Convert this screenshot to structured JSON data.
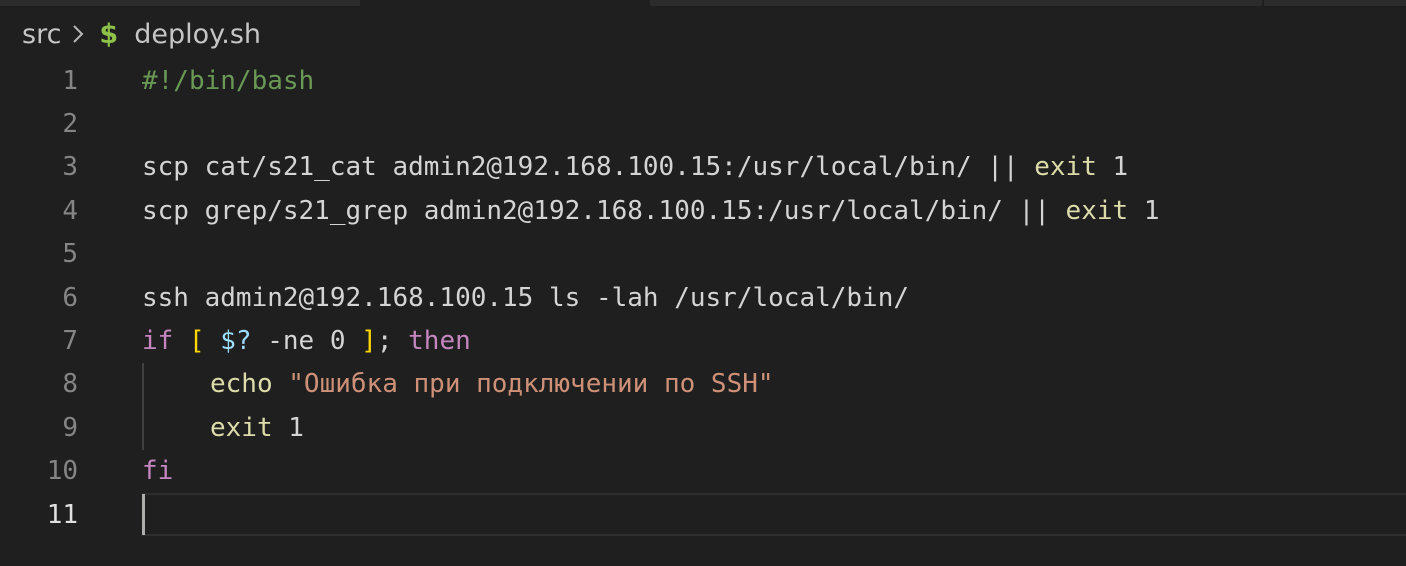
{
  "breadcrumb": {
    "folder": "src",
    "file_icon": "$",
    "file": "deploy.sh"
  },
  "lines": [
    {
      "n": "1",
      "tokens": [
        {
          "t": "#!/bin/bash",
          "c": "comment"
        }
      ]
    },
    {
      "n": "2",
      "tokens": []
    },
    {
      "n": "3",
      "tokens": [
        {
          "t": "scp cat/s21_cat admin2@192.168.100.15:/usr/local/bin/ || ",
          "c": "plain"
        },
        {
          "t": "exit",
          "c": "fn"
        },
        {
          "t": " 1",
          "c": "num"
        }
      ]
    },
    {
      "n": "4",
      "tokens": [
        {
          "t": "scp grep/s21_grep admin2@192.168.100.15:/usr/local/bin/ || ",
          "c": "plain"
        },
        {
          "t": "exit",
          "c": "fn"
        },
        {
          "t": " 1",
          "c": "num"
        }
      ]
    },
    {
      "n": "5",
      "tokens": []
    },
    {
      "n": "6",
      "tokens": [
        {
          "t": "ssh admin2@192.168.100.15 ls -lah /usr/local/bin/",
          "c": "plain"
        }
      ]
    },
    {
      "n": "7",
      "tokens": [
        {
          "t": "if",
          "c": "kw"
        },
        {
          "t": " ",
          "c": "plain"
        },
        {
          "t": "[",
          "c": "bracket"
        },
        {
          "t": " ",
          "c": "plain"
        },
        {
          "t": "$?",
          "c": "var"
        },
        {
          "t": " -ne 0 ",
          "c": "plain"
        },
        {
          "t": "]",
          "c": "bracket"
        },
        {
          "t": "; ",
          "c": "plain"
        },
        {
          "t": "then",
          "c": "kw"
        }
      ]
    },
    {
      "n": "8",
      "indent": 1,
      "tokens": [
        {
          "t": "echo",
          "c": "fn"
        },
        {
          "t": " ",
          "c": "plain"
        },
        {
          "t": "\"Ошибка при подключении по SSH\"",
          "c": "str"
        }
      ]
    },
    {
      "n": "9",
      "indent": 1,
      "tokens": [
        {
          "t": "exit",
          "c": "fn"
        },
        {
          "t": " 1",
          "c": "num"
        }
      ]
    },
    {
      "n": "10",
      "tokens": [
        {
          "t": "fi",
          "c": "kw"
        }
      ]
    },
    {
      "n": "11",
      "active": true,
      "tokens": []
    }
  ],
  "colors": {
    "background": "#1f1f1f",
    "comment": "#6a9955",
    "keyword": "#c586c0",
    "function": "#dcdcaa",
    "string": "#ce9178",
    "variable": "#9cdcfe",
    "bracket": "#ffd700"
  }
}
